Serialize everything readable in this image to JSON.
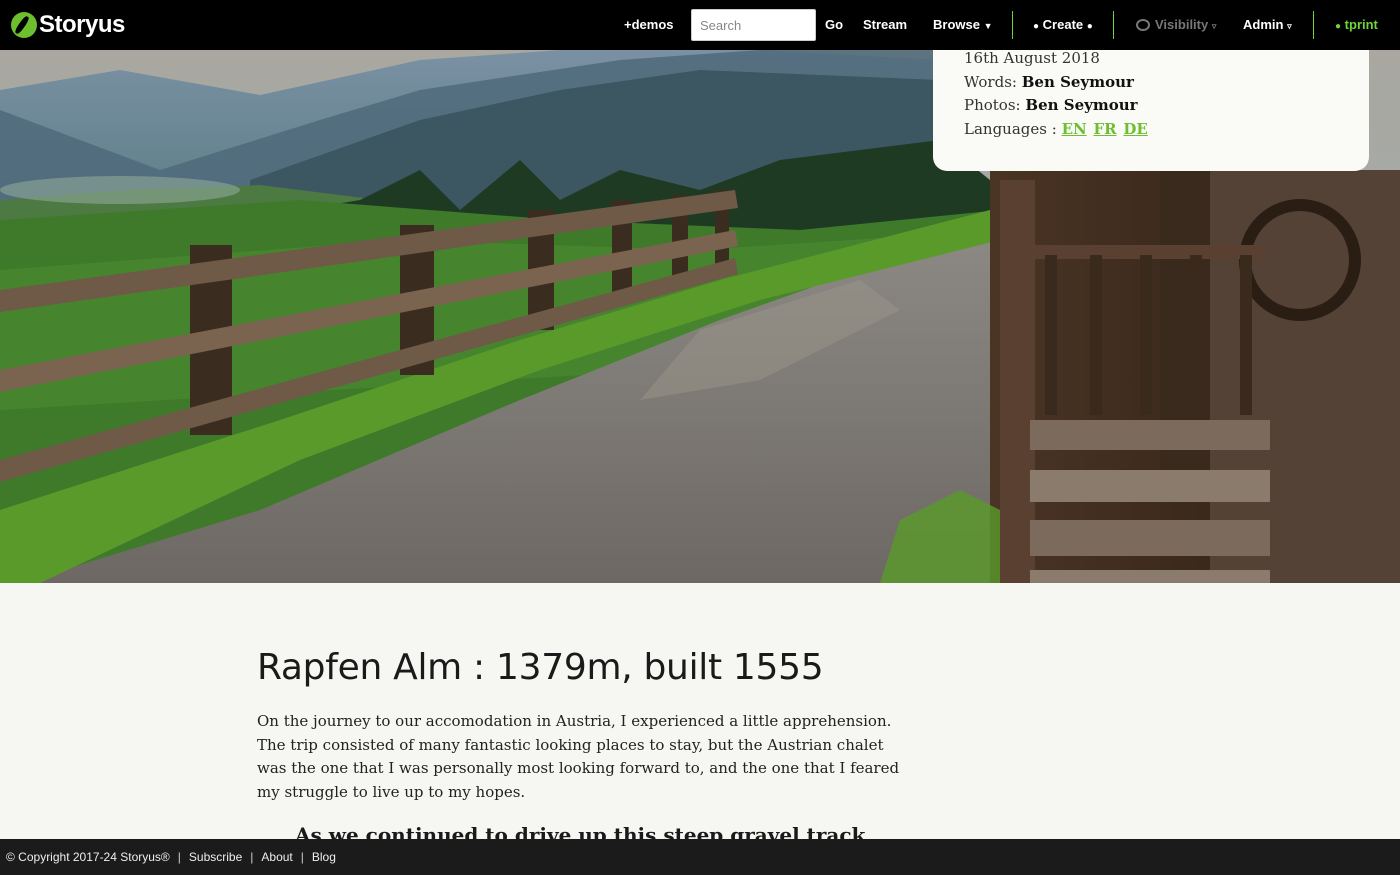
{
  "header": {
    "brand": "Storyus",
    "demos": "+demos",
    "search_placeholder": "Search",
    "go": "Go",
    "stream": "Stream",
    "browse": "Browse",
    "create": "Create",
    "visibility": "Visibility",
    "admin": "Admin",
    "user": "tprint"
  },
  "meta": {
    "date": "16th August 2018",
    "words_label": "Words:",
    "words_author": "Ben Seymour",
    "photos_label": "Photos:",
    "photos_author": "Ben Seymour",
    "languages_label": "Languages :",
    "languages": [
      "EN",
      "FR",
      "DE"
    ]
  },
  "hero": {
    "image": "mountain-path-chalet"
  },
  "article": {
    "title": "Rapfen Alm : 1379m, built 1555",
    "body": "On the journey to our accomodation in Austria, I experienced a little apprehension. The trip consisted of many fantastic looking places to stay, but the Austrian chalet was the one that I was personally most looking forward to, and the one that I feared my struggle to live up to my hopes.",
    "quote": "As we continued to drive up this steep gravel track"
  },
  "footer": {
    "copyright": "© Copyright 2017-24 Storyus®",
    "separator": "|",
    "subscribe": "Subscribe",
    "about": "About",
    "blog": "Blog"
  },
  "colors": {
    "accent": "#6dd43c",
    "link": "#6dbf2e",
    "topbar": "#000000",
    "footer": "#1b1b1b",
    "page_background": "#f6f6f3"
  }
}
